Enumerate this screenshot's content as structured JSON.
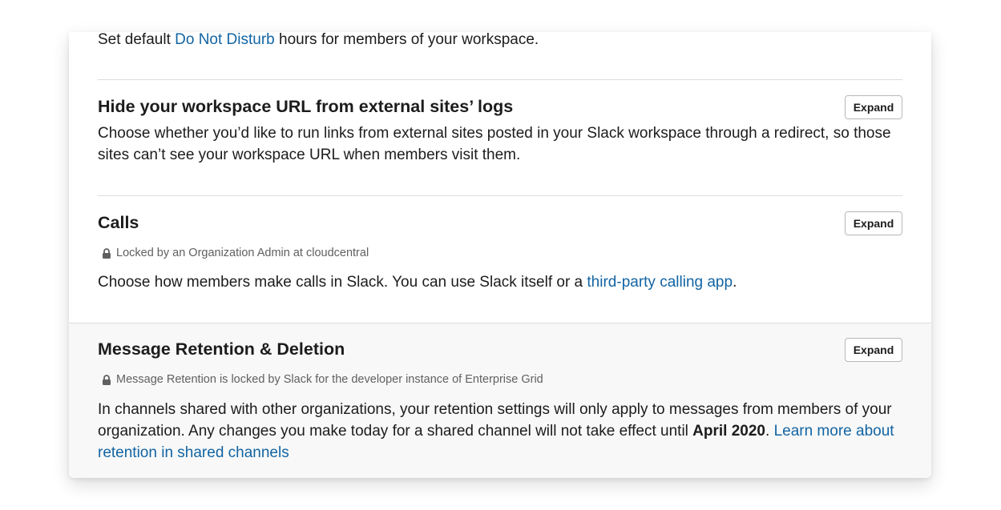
{
  "dnd": {
    "before": "Set default ",
    "link": "Do Not Disturb",
    "after": " hours for members of your workspace."
  },
  "hide_url": {
    "title": "Hide your workspace URL from external sites’ logs",
    "description": "Choose whether you’d like to run links from external sites posted in your Slack workspace through a redirect, so those sites can’t see your workspace URL when members visit them.",
    "expand_label": "Expand"
  },
  "calls": {
    "title": "Calls",
    "locked_text": "Locked by an Organization Admin at cloudcentral",
    "description_before": "Choose how members make calls in Slack. You can use Slack itself or a ",
    "description_link": "third-party calling app",
    "description_after": ".",
    "expand_label": "Expand"
  },
  "retention": {
    "title": "Message Retention & Deletion",
    "locked_text": "Message Retention is locked by Slack for the developer instance of Enterprise Grid",
    "description_before": "In channels shared with other organizations, your retention settings will only apply to messages from members of your organization. Any changes you make today for a shared channel will not take effect until ",
    "description_bold": "April 2020",
    "description_mid": ". ",
    "description_link": "Learn more about retention in shared channels",
    "expand_label": "Expand"
  },
  "colors": {
    "link": "#1264a3",
    "text": "#1d1c1d",
    "muted": "#616061"
  },
  "icons": {
    "lock": "lock-icon"
  }
}
